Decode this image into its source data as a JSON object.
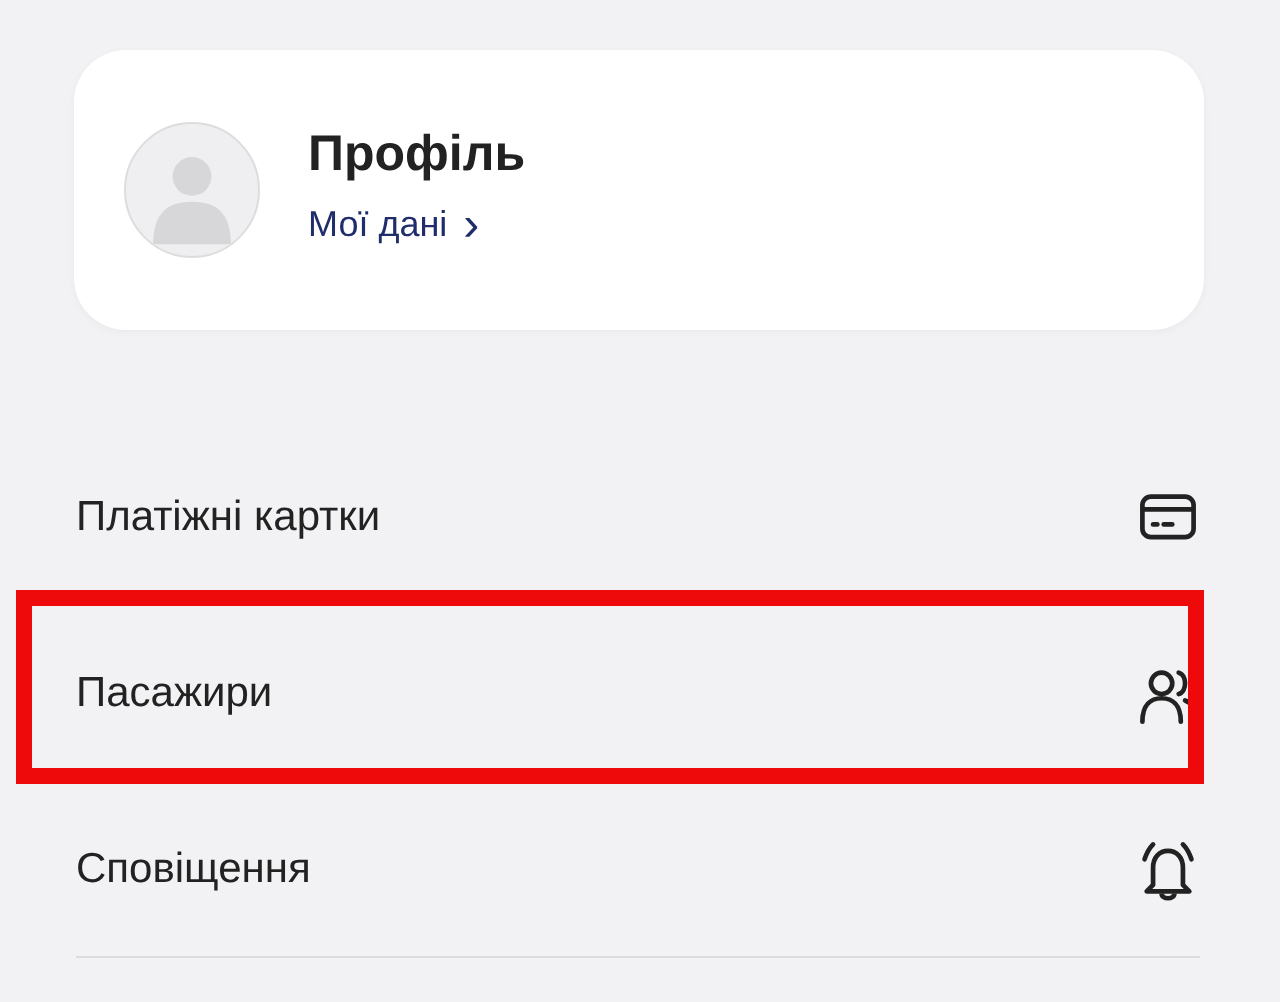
{
  "profile": {
    "title": "Профіль",
    "link": "Мої дані",
    "link_chevron": "›"
  },
  "menu": [
    {
      "label": "Платіжні картки",
      "kind": "card",
      "highlighted": false
    },
    {
      "label": "Пасажири",
      "kind": "passengers",
      "highlighted": true
    },
    {
      "label": "Сповіщення",
      "kind": "bell",
      "highlighted": false
    }
  ]
}
